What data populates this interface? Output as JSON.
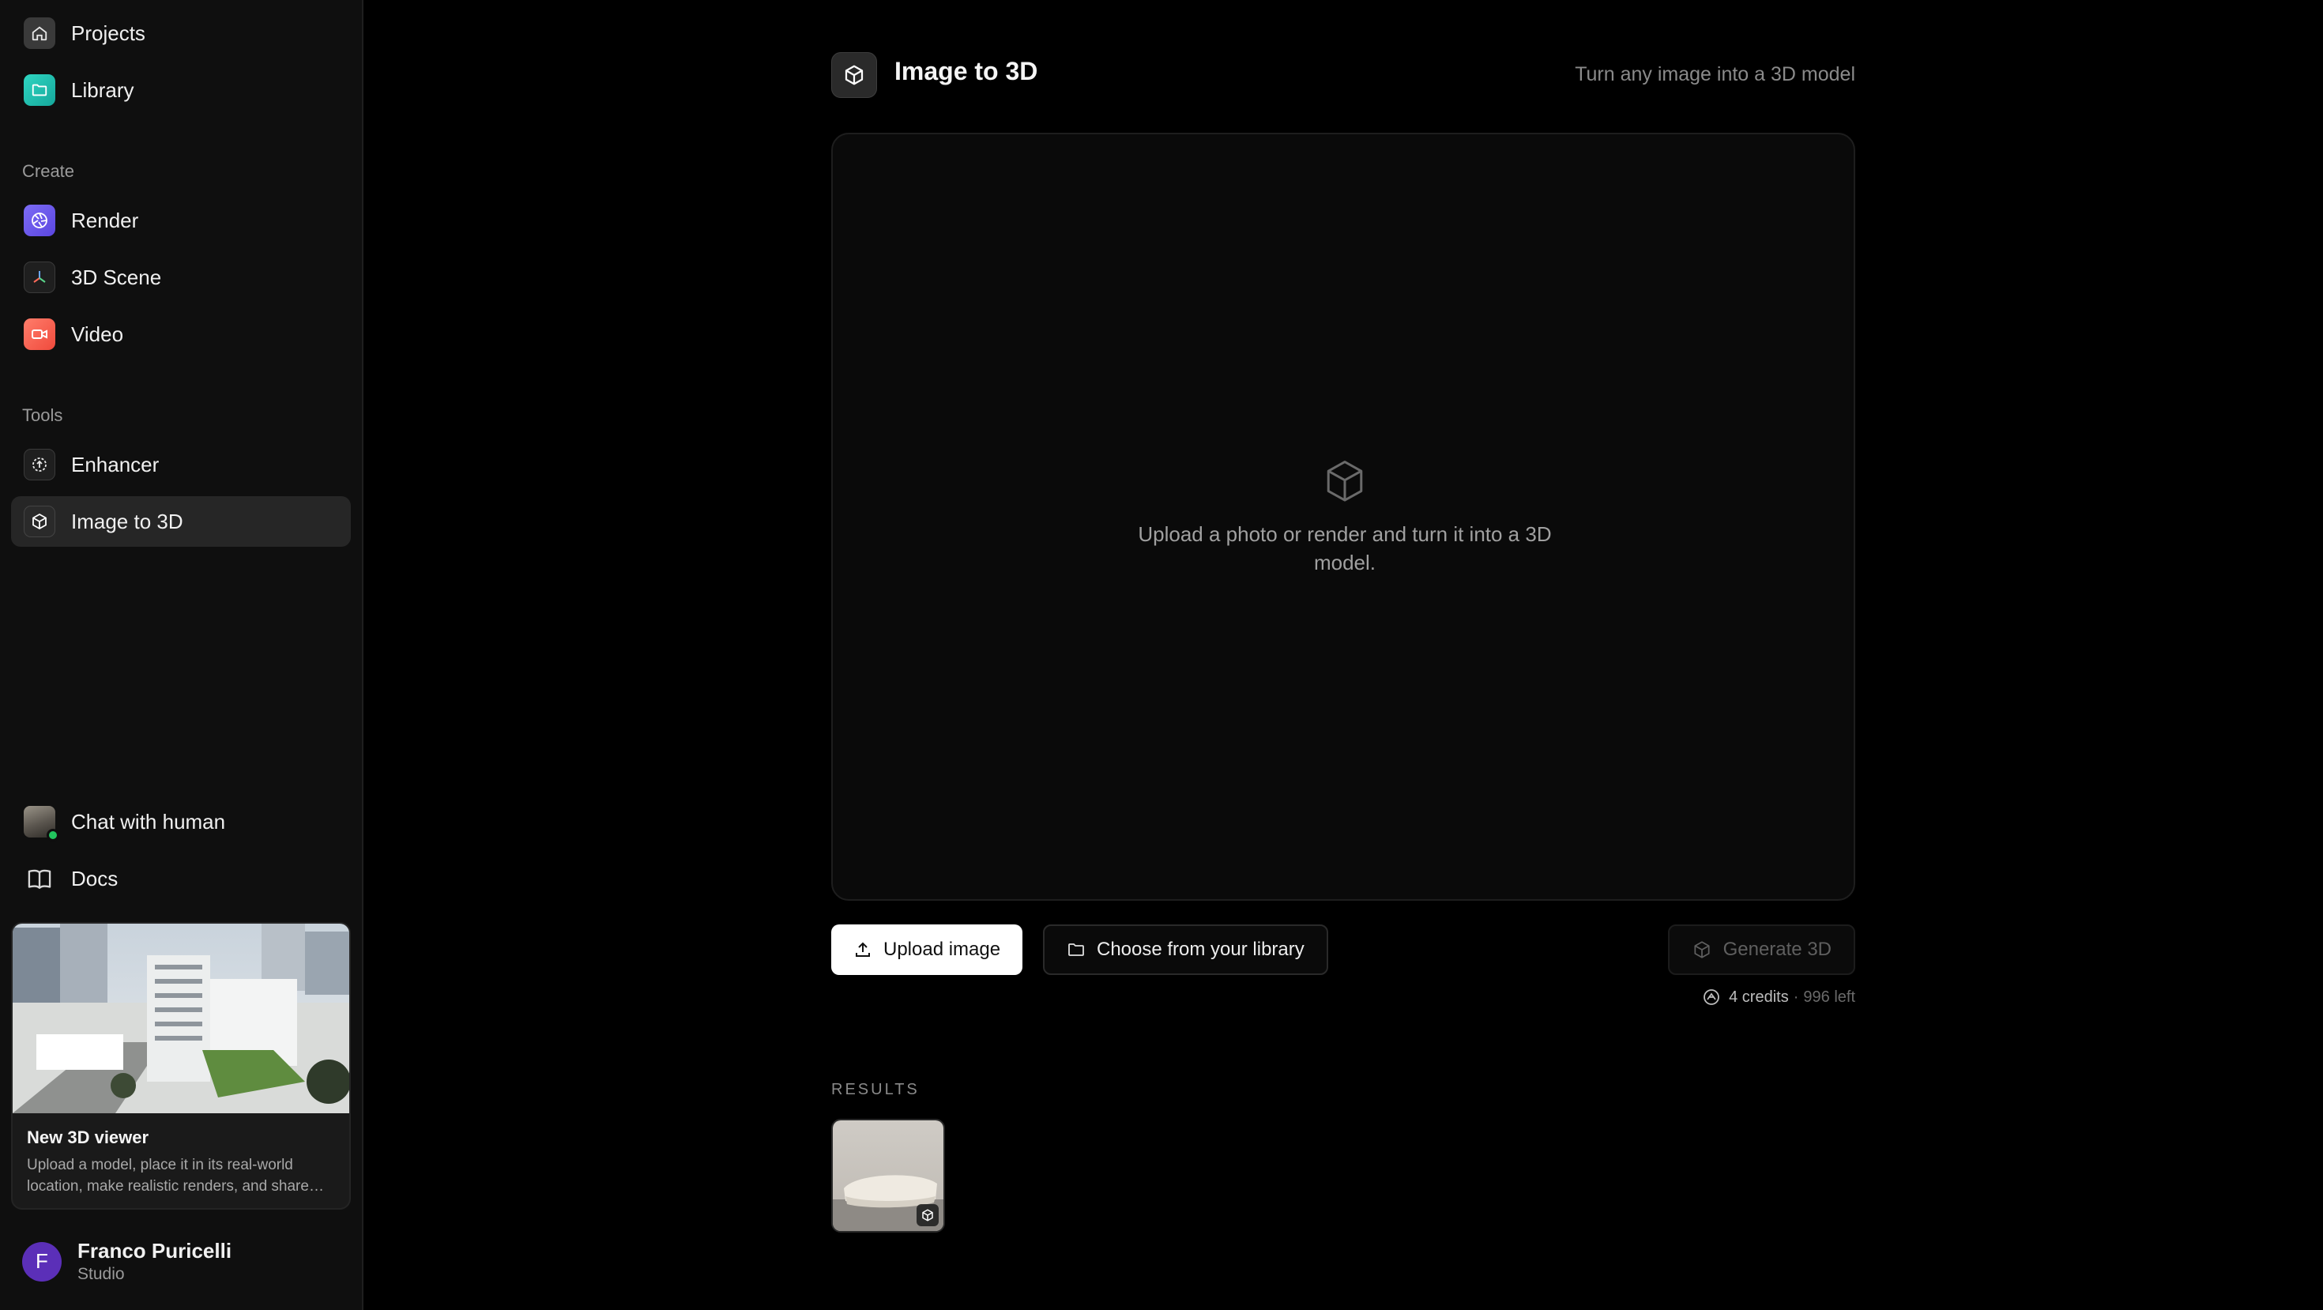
{
  "sidebar": {
    "top_items": [
      {
        "label": "Projects",
        "icon": "home-icon"
      },
      {
        "label": "Library",
        "icon": "folder-icon"
      }
    ],
    "create_label": "Create",
    "create_items": [
      {
        "label": "Render",
        "icon": "aperture-icon"
      },
      {
        "label": "3D Scene",
        "icon": "axes-icon"
      },
      {
        "label": "Video",
        "icon": "video-camera-icon"
      }
    ],
    "tools_label": "Tools",
    "tools_items": [
      {
        "label": "Enhancer",
        "icon": "enhance-icon"
      },
      {
        "label": "Image to 3D",
        "icon": "cube-icon",
        "active": true
      }
    ],
    "bottom_items": [
      {
        "label": "Chat with human",
        "icon": "avatar"
      },
      {
        "label": "Docs",
        "icon": "book-icon"
      }
    ],
    "promo": {
      "title": "New 3D viewer",
      "text": "Upload a model, place it in its real-world location, make realistic renders, and share them with your team."
    },
    "user": {
      "initial": "F",
      "name": "Franco Puricelli",
      "plan": "Studio"
    }
  },
  "main": {
    "title": "Image to 3D",
    "subtitle": "Turn any image into a 3D model",
    "dropzone_text": "Upload a photo or render and turn it into a 3D model.",
    "upload_button": "Upload image",
    "library_button": "Choose from your library",
    "generate_button": "Generate 3D",
    "credits": "4 credits",
    "credits_sep": "·",
    "credits_left": "996 left",
    "results_label": "RESULTS"
  },
  "colors": {
    "background": "#000000",
    "sidebar": "#0f0f0f",
    "active_item": "#262626",
    "accent_purple": "#5b46e0",
    "accent_teal": "#15a79b",
    "accent_red": "#f04a3c",
    "user_avatar": "#5b2fb8",
    "online": "#22c55e"
  }
}
